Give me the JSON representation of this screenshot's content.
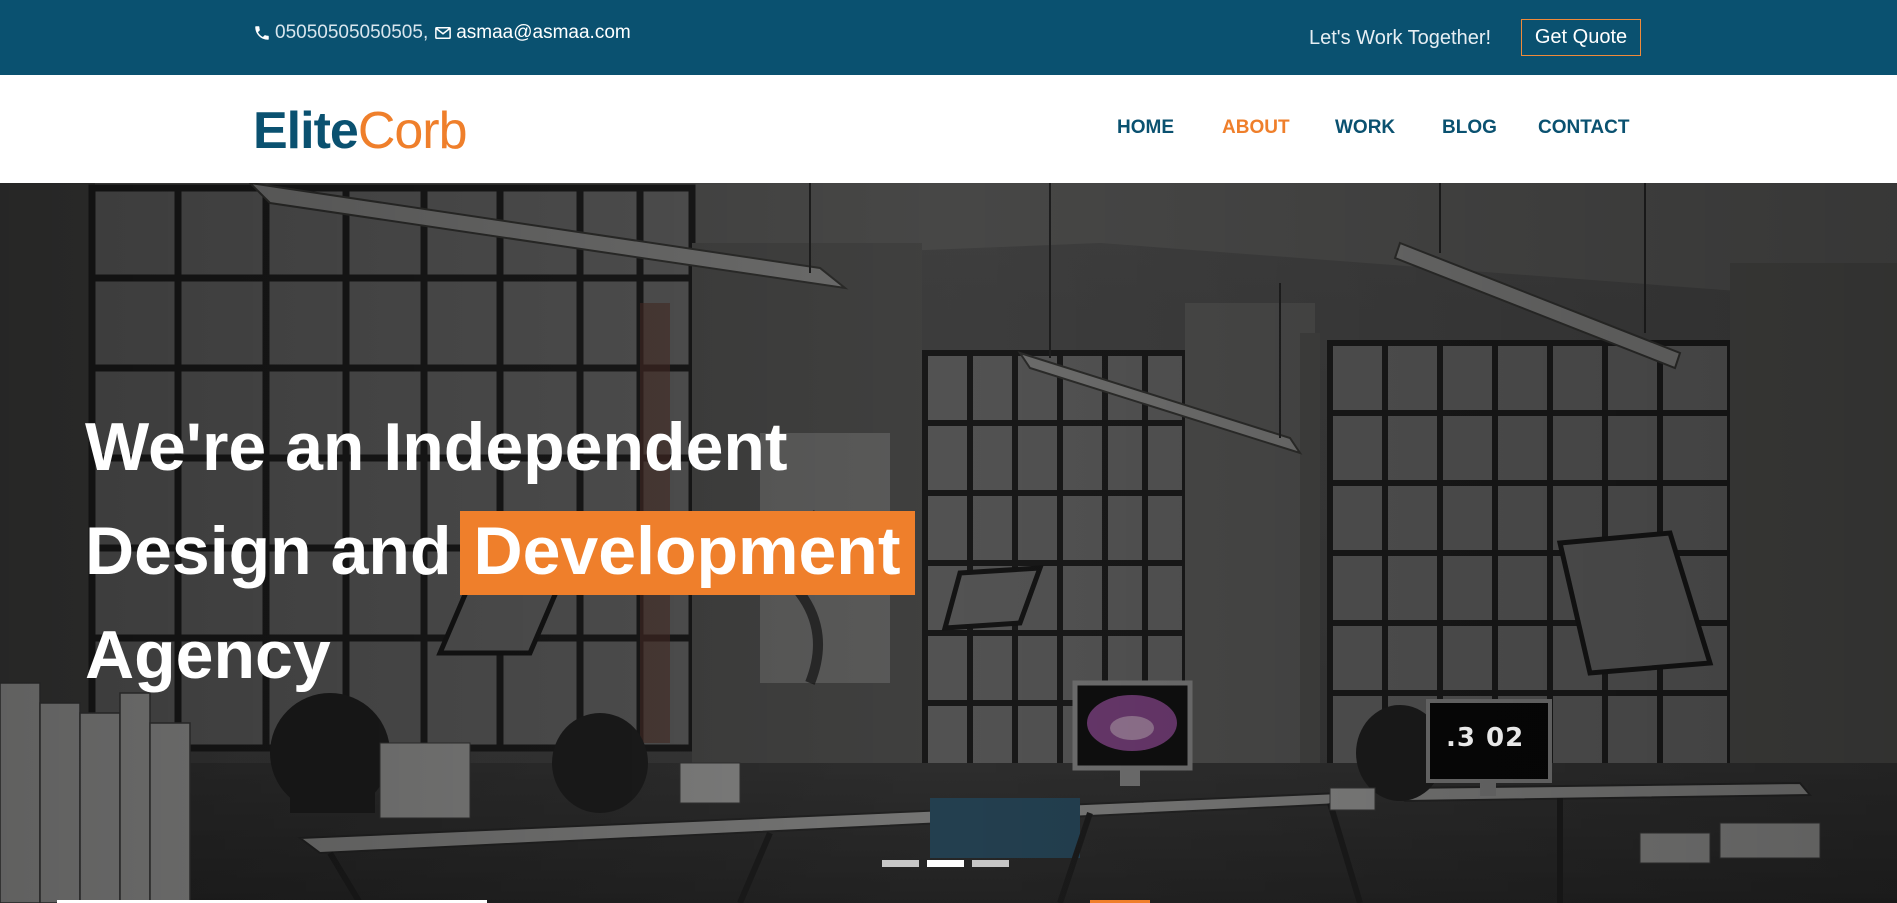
{
  "topbar": {
    "phone": "05050505050505",
    "separator": ",",
    "email": "asmaa@asmaa.com",
    "tagline": "Let's Work Together!",
    "quote_button": "Get Quote",
    "icons": [
      "phone-icon",
      "envelope-icon"
    ]
  },
  "brand": {
    "part1": "Elite",
    "part2": "Corb"
  },
  "nav": {
    "items": [
      {
        "label": "HOME",
        "active": false
      },
      {
        "label": "ABOUT",
        "active": true
      },
      {
        "label": "WORK",
        "active": false
      },
      {
        "label": "BLOG",
        "active": false
      },
      {
        "label": "CONTACT",
        "active": false
      }
    ]
  },
  "hero": {
    "line1": "We're an Independent",
    "line2a": "Design and",
    "line2b": "Development",
    "line3": "Agency",
    "monitor_text": ".3 02",
    "slide_count": 3,
    "active_slide": 2
  },
  "colors": {
    "primary": "#0a5170",
    "accent": "#ef7f2b",
    "white": "#ffffff"
  }
}
